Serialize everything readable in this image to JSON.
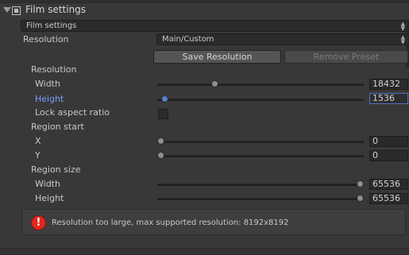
{
  "header": {
    "title": "Film settings"
  },
  "preset_dropdown": {
    "value": "Film settings"
  },
  "resolution_row": {
    "label": "Resolution",
    "value": "Main/Custom"
  },
  "buttons": {
    "save": "Save Resolution",
    "remove": "Remove Preset"
  },
  "resolution_section": {
    "title": "Resolution",
    "width": {
      "label": "Width",
      "value": "18432",
      "slider_fraction": 0.27
    },
    "height": {
      "label": "Height",
      "value": "1536",
      "slider_fraction": 0.02
    },
    "lock_label": "Lock aspect ratio",
    "lock_checked": false
  },
  "region_start": {
    "title": "Region start",
    "x": {
      "label": "X",
      "value": "0",
      "slider_fraction": 0.0
    },
    "y": {
      "label": "Y",
      "value": "0",
      "slider_fraction": 0.0
    }
  },
  "region_size": {
    "title": "Region size",
    "width": {
      "label": "Width",
      "value": "65536",
      "slider_fraction": 1.0
    },
    "height": {
      "label": "Height",
      "value": "65536",
      "slider_fraction": 1.0
    }
  },
  "error": {
    "icon": "error-icon",
    "message": "Resolution too large, max supported resolution: 8192x8192"
  },
  "colors": {
    "accent": "#5a7bd6",
    "error": "#e0271d",
    "background": "#383838"
  }
}
